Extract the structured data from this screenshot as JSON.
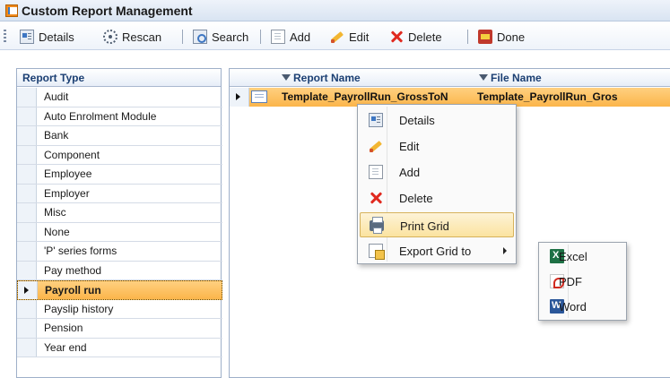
{
  "window": {
    "title": "Custom Report Management"
  },
  "toolbar": {
    "items": [
      {
        "label": "Details",
        "icon": "details-icon"
      },
      {
        "label": "Rescan",
        "icon": "rescan-icon"
      },
      {
        "label": "Search",
        "icon": "search-icon"
      },
      {
        "label": "Add",
        "icon": "add-icon"
      },
      {
        "label": "Edit",
        "icon": "edit-icon"
      },
      {
        "label": "Delete",
        "icon": "delete-icon"
      },
      {
        "label": "Done",
        "icon": "done-icon"
      }
    ]
  },
  "report_type": {
    "header": "Report Type",
    "items": [
      {
        "label": "Audit"
      },
      {
        "label": "Auto Enrolment Module"
      },
      {
        "label": "Bank"
      },
      {
        "label": "Component"
      },
      {
        "label": "Employee"
      },
      {
        "label": "Employer"
      },
      {
        "label": "Misc"
      },
      {
        "label": "None"
      },
      {
        "label": "'P' series forms"
      },
      {
        "label": "Pay method"
      },
      {
        "label": "Payroll run"
      },
      {
        "label": "Payslip history"
      },
      {
        "label": "Pension"
      },
      {
        "label": "Year end"
      }
    ],
    "selected": "Payroll run"
  },
  "grid": {
    "columns": [
      {
        "label": "Report Name"
      },
      {
        "label": "File Name"
      }
    ],
    "rows": [
      {
        "report_name": "Template_PayrollRun_GrossToN",
        "file_name": "Template_PayrollRun_Gros"
      }
    ]
  },
  "context_menu": {
    "items": [
      {
        "label": "Details",
        "icon": "details-icon"
      },
      {
        "label": "Edit",
        "icon": "edit-icon"
      },
      {
        "label": "Add",
        "icon": "add-icon"
      },
      {
        "label": "Delete",
        "icon": "delete-icon"
      },
      {
        "label": "Print Grid",
        "icon": "print-icon",
        "highlighted": true
      },
      {
        "label": "Export Grid to",
        "icon": "export-icon",
        "has_submenu": true
      }
    ]
  },
  "export_submenu": {
    "items": [
      {
        "label": "Excel",
        "icon": "excel-icon"
      },
      {
        "label": "PDF",
        "icon": "pdf-icon"
      },
      {
        "label": "Word",
        "icon": "word-icon"
      }
    ]
  },
  "colors": {
    "selection": "#fbb54a",
    "header_text": "#1b3f73",
    "menu_hover": "#fbe3a0"
  }
}
